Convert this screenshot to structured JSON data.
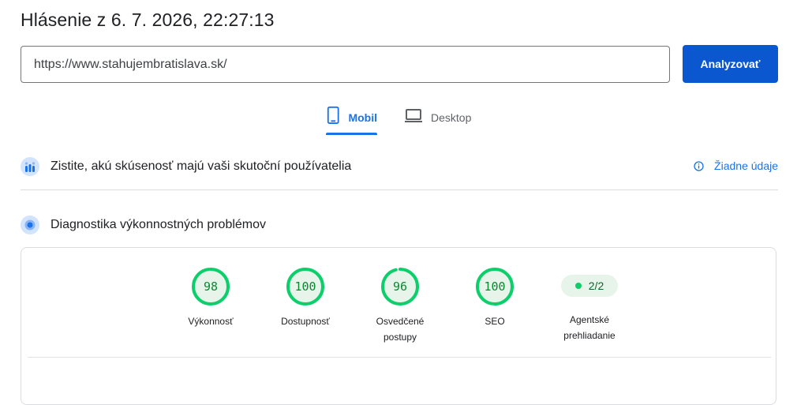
{
  "header": {
    "title": "Hlásenie z 6. 7. 2026, 22:27:13"
  },
  "search": {
    "url_value": "https://www.stahujembratislava.sk/",
    "analyze_label": "Analyzovať"
  },
  "tabs": [
    {
      "label": "Mobil",
      "icon": "smartphone-icon",
      "selected": true
    },
    {
      "label": "Desktop",
      "icon": "laptop-icon",
      "selected": false
    }
  ],
  "crux": {
    "title": "Zistite, akú skúsenosť majú vaši skutoční používatelia",
    "status_link": "Žiadne údaje",
    "icon": "users-chart-icon"
  },
  "diagnostics": {
    "title": "Diagnostika výkonnostných problémov",
    "icon": "lighthouse-icon",
    "scores": [
      {
        "value": "98",
        "fraction": 0.98,
        "label": "Výkonnosť"
      },
      {
        "value": "100",
        "fraction": 1.0,
        "label": "Dostupnosť"
      },
      {
        "value": "96",
        "fraction": 0.96,
        "label": "Osvedčené postupy"
      },
      {
        "value": "100",
        "fraction": 1.0,
        "label": "SEO"
      }
    ],
    "agentic": {
      "value": "2/2",
      "label": "Agentské prehliadanie"
    }
  },
  "colors": {
    "accent": "#1a73e8",
    "button": "#0b57d0",
    "pass": "#0cce6b",
    "pass_text": "#0a8a2e"
  }
}
